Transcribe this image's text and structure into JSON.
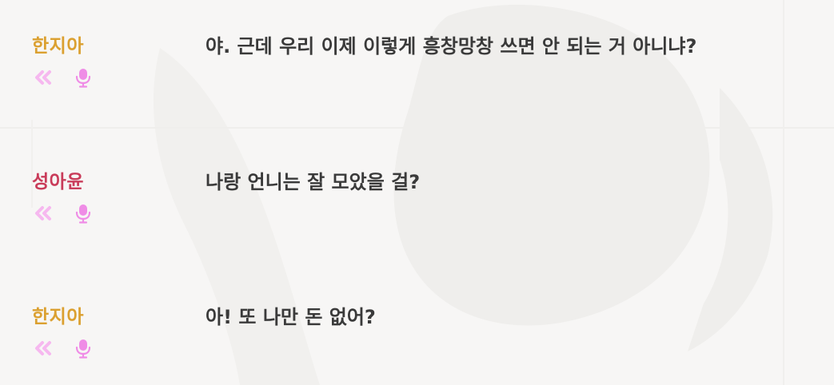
{
  "colors": {
    "background": "#f7f6f5",
    "text": "#3a3a3a",
    "icon": "#ef8ce6",
    "icon_light": "#f6b8ef",
    "speaker_hanjia": "#dba030",
    "speaker_seongayun": "#c93c5a"
  },
  "icons": {
    "replay": "double-chevron-left-icon",
    "voice": "microphone-icon"
  },
  "entries": [
    {
      "speaker": "한지아",
      "speaker_color": "#dba030",
      "text": "야. 근데 우리 이제 이렇게 흥창망창 쓰면 안 되는 거 아니냐?"
    },
    {
      "speaker": "성아윤",
      "speaker_color": "#c93c5a",
      "text": "나랑 언니는 잘 모았을 걸?"
    },
    {
      "speaker": "한지아",
      "speaker_color": "#dba030",
      "text": "아! 또 나만 돈 없어?"
    }
  ]
}
